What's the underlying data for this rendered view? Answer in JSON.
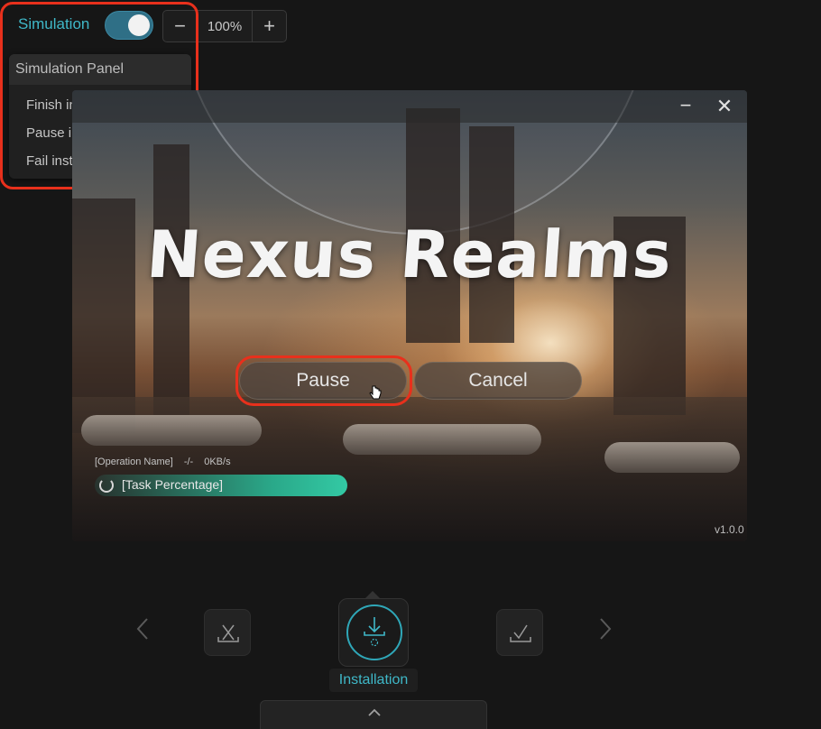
{
  "toolbar": {
    "simulation_label": "Simulation",
    "simulation_enabled": true,
    "zoom_minus": "−",
    "zoom_value": "100%",
    "zoom_plus": "+"
  },
  "simulation_panel": {
    "title": "Simulation Panel",
    "items": [
      "Finish installation",
      "Pause installation",
      "Fail installation"
    ]
  },
  "launcher": {
    "game_title": "Nexus Realms",
    "minimize": "−",
    "close": "✕",
    "pause_label": "Pause",
    "cancel_label": "Cancel",
    "operation_name": "[Operation Name]",
    "operation_eta": "-/-",
    "operation_speed": "0KB/s",
    "task_percentage": "[Task Percentage]",
    "version": "v1.0.0"
  },
  "stepper": {
    "steps": [
      {
        "name": "cancel-step",
        "icon": "x-tray-icon"
      },
      {
        "name": "installation-step",
        "icon": "download-icon",
        "active": true
      },
      {
        "name": "finish-step",
        "icon": "check-tray-icon"
      }
    ],
    "active_label": "Installation"
  },
  "colors": {
    "accent": "#3fb8c8",
    "highlight": "#e8301c",
    "progress": "#2aa889"
  }
}
